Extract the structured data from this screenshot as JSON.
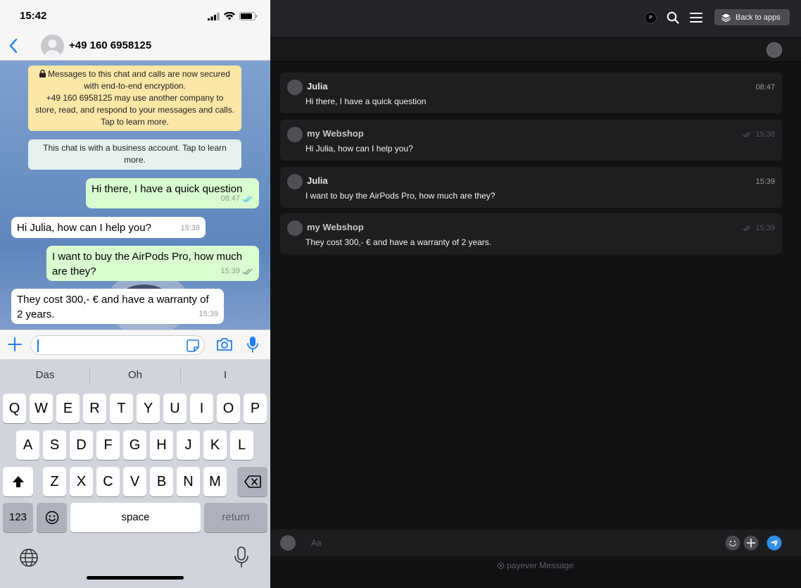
{
  "phone": {
    "status": {
      "time": "15:42"
    },
    "header": {
      "contact_name": "+49 160 6958125"
    },
    "notices": {
      "encryption_line1": "Messages to this chat and calls are now secured with end-to-end encryption.",
      "encryption_line2": "+49 160 6958125 may use another company to store, read, and respond to your messages and calls. Tap to learn more.",
      "business": "This chat is with a business account. Tap to learn more."
    },
    "messages": [
      {
        "text": "Hi there, I have a quick question",
        "time": "08:47",
        "direction": "out",
        "status": "read"
      },
      {
        "text": "Hi Julia, how can I help you?",
        "time": "15:38",
        "direction": "in"
      },
      {
        "text": "I want to buy the AirPods Pro, how much are they?",
        "time": "15:39",
        "direction": "out",
        "status": "delivered"
      },
      {
        "text": "They cost 300,- € and have a warranty of 2 years.",
        "time": "15:39",
        "direction": "in"
      }
    ],
    "input": {
      "value": "",
      "placeholder": ""
    },
    "keyboard": {
      "suggestions": [
        "Das",
        "Oh",
        "I"
      ],
      "row1": [
        "Q",
        "W",
        "E",
        "R",
        "T",
        "Y",
        "U",
        "I",
        "O",
        "P"
      ],
      "row2": [
        "A",
        "S",
        "D",
        "F",
        "G",
        "H",
        "J",
        "K",
        "L"
      ],
      "row3": [
        "Z",
        "X",
        "C",
        "V",
        "B",
        "N",
        "M"
      ],
      "numbers_label": "123",
      "space_label": "space",
      "return_label": "return"
    },
    "colors": {
      "outgoing": "#d9fdd0",
      "incoming": "#ffffff",
      "encryption_notice": "#fbe7a6",
      "read_ticks": "#53bdeb"
    }
  },
  "desktop": {
    "topbar": {
      "back_label": "Back to apps",
      "brand_mark": "P"
    },
    "messages": [
      {
        "author": "Julia",
        "text": "Hi there, I have a quick question",
        "time": "08:47",
        "ticks": false
      },
      {
        "author": "my Webshop",
        "text": "Hi Julia, how can I help you?",
        "time": "15:38",
        "ticks": true
      },
      {
        "author": "Julia",
        "text": "I want to buy the AirPods Pro, how much are they?",
        "time": "15:39",
        "ticks": false
      },
      {
        "author": "my Webshop",
        "text": "They cost 300,- € and have a warranty of 2 years.",
        "time": "15:39",
        "ticks": true
      }
    ],
    "composer": {
      "placeholder": "Aa",
      "value": ""
    },
    "footer": {
      "brand": "payever",
      "product": "Message"
    },
    "colors": {
      "background": "#111214",
      "card": "#1d1e20",
      "send": "#2f8fe8"
    }
  }
}
